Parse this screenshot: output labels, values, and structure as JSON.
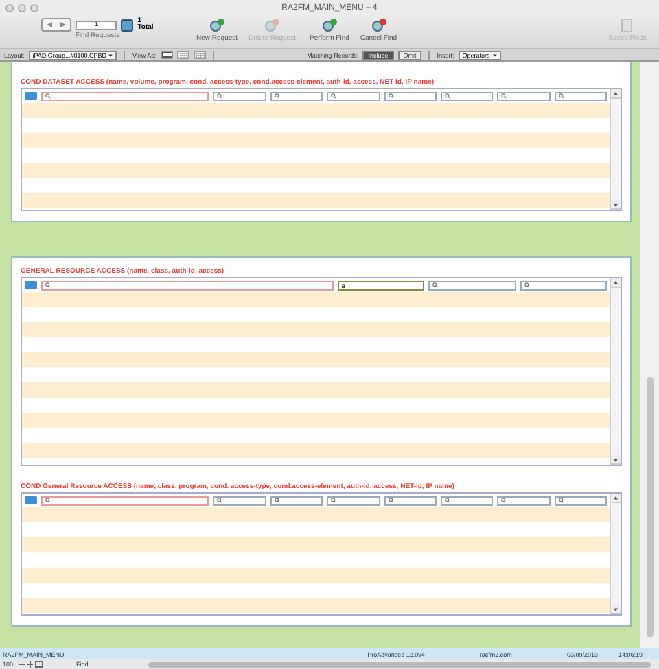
{
  "window": {
    "title": "RA2FM_MAIN_MENU – 4"
  },
  "toolbar": {
    "record": "1",
    "total_count": "1",
    "total_label": "Total",
    "find_requests": "Find Requests",
    "buttons": [
      {
        "label": "New Request",
        "kind": "new",
        "disabled": false
      },
      {
        "label": "Delete Request",
        "kind": "delete",
        "disabled": true
      },
      {
        "label": "Perform Find",
        "kind": "perform",
        "disabled": false
      },
      {
        "label": "Cancel Find",
        "kind": "cancel",
        "disabled": false
      }
    ],
    "saved_finds": {
      "label": "Saved Finds",
      "disabled": true
    }
  },
  "layout_bar": {
    "layout_label": "Layout:",
    "layout_value": "iPAD Group...#0100.CPBD",
    "view_as_label": "View As:",
    "view_modes": [
      {
        "kind": "form",
        "selected": true
      },
      {
        "kind": "list",
        "selected": false
      },
      {
        "kind": "table",
        "selected": false
      }
    ],
    "matching_label": "Matching Records:",
    "matching": [
      {
        "label": "Include",
        "selected": true
      },
      {
        "label": "Omit",
        "selected": false
      }
    ],
    "insert_label": "Insert:",
    "insert_value": "Operators"
  },
  "panels": [
    {
      "top_cut": true,
      "sections": [
        {
          "title": "COND DATASET ACCESS (name, volume, program, cond. access-type, cond.access-element, auth-id, access, NET-id, IP name)",
          "tall": false,
          "fields": [
            {
              "wide": true,
              "focused": false
            },
            {
              "wide": false,
              "focused": false
            },
            {
              "wide": false,
              "focused": false
            },
            {
              "wide": false,
              "focused": false
            },
            {
              "wide": false,
              "focused": false
            },
            {
              "wide": false,
              "focused": false
            },
            {
              "wide": false,
              "focused": false
            },
            {
              "wide": false,
              "focused": false
            }
          ]
        }
      ]
    },
    {
      "top_cut": false,
      "sections": [
        {
          "title": "GENERAL RESOURCE ACCESS (name, class, auth-id, access)",
          "tall": true,
          "fields": [
            {
              "wide": true,
              "focused": false
            },
            {
              "wide": false,
              "focused": true,
              "value": "a"
            },
            {
              "wide": false,
              "focused": false
            },
            {
              "wide": false,
              "focused": false
            }
          ]
        },
        {
          "title": "COND General Resource ACCESS (name, class, program, cond. access-type, cond.access-element, auth-id, access, NET-id, IP name)",
          "tall": false,
          "fields": [
            {
              "wide": true,
              "focused": false
            },
            {
              "wide": false,
              "focused": false
            },
            {
              "wide": false,
              "focused": false
            },
            {
              "wide": false,
              "focused": false
            },
            {
              "wide": false,
              "focused": false
            },
            {
              "wide": false,
              "focused": false
            },
            {
              "wide": false,
              "focused": false
            },
            {
              "wide": false,
              "focused": false
            }
          ]
        }
      ]
    }
  ],
  "status_bar": {
    "layout_name": "RA2FM_MAIN_MENU",
    "version": "ProAdvanced 12.0v4",
    "site": "racfm2.com",
    "date": "03/09/2013",
    "time": "14:06:19"
  },
  "bottom_bar": {
    "zoom": "100",
    "mode": "Find"
  }
}
